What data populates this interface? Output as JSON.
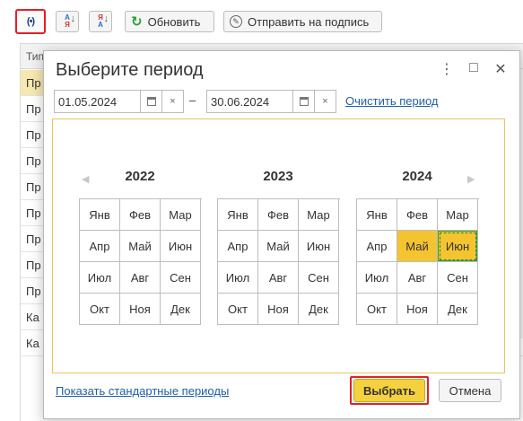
{
  "toolbar": {
    "refresh_label": "Обновить",
    "send_label": "Отправить на подпись",
    "sort_asc_icon": "sort-az-icon",
    "sort_desc_icon": "sort-za-icon",
    "signal_icon": "broadcast-icon"
  },
  "list": {
    "header": "Тип",
    "rows": [
      "Пр",
      "Пр",
      "Пр",
      "Пр",
      "Пр",
      "Пр",
      "Пр",
      "Пр",
      "Пр",
      "Ка",
      "Ка"
    ]
  },
  "dialog": {
    "title": "Выберите период",
    "start_date": "01.05.2024",
    "end_date": "30.06.2024",
    "dash": "–",
    "clear_label": "Очистить период",
    "show_standard_label": "Показать стандартные периоды",
    "ok_label": "Выбрать",
    "cancel_label": "Отмена",
    "menu_glyph": "⋮",
    "maximize_glyph": "□",
    "close_glyph": "✕",
    "clear_glyph": "×",
    "prev_glyph": "◀",
    "next_glyph": "▶"
  },
  "calendar": {
    "years": [
      {
        "year": "2022",
        "months": [
          "Янв",
          "Фев",
          "Мар",
          "Апр",
          "Май",
          "Июн",
          "Июл",
          "Авг",
          "Сен",
          "Окт",
          "Ноя",
          "Дек"
        ]
      },
      {
        "year": "2023",
        "months": [
          "Янв",
          "Фев",
          "Мар",
          "Апр",
          "Май",
          "Июн",
          "Июл",
          "Авг",
          "Сен",
          "Окт",
          "Ноя",
          "Дек"
        ]
      },
      {
        "year": "2024",
        "months": [
          "Янв",
          "Фев",
          "Мар",
          "Апр",
          "Май",
          "Июн",
          "Июл",
          "Авг",
          "Сен",
          "Окт",
          "Ноя",
          "Дек"
        ]
      }
    ],
    "selected": [
      "2024-05",
      "2024-06"
    ]
  },
  "colors": {
    "accent": "#f4c430",
    "highlight_frame": "#e0202a",
    "link": "#1f5ea8"
  }
}
